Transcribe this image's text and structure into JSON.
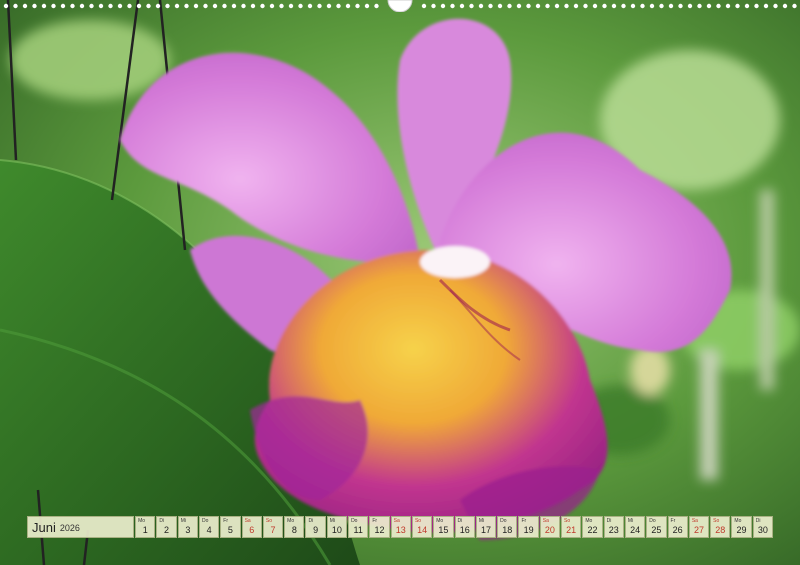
{
  "calendar": {
    "month": "Juni",
    "year": "2026",
    "days": [
      {
        "wd": "Mo",
        "d": "1",
        "weekend": false
      },
      {
        "wd": "Di",
        "d": "2",
        "weekend": false
      },
      {
        "wd": "Mi",
        "d": "3",
        "weekend": false
      },
      {
        "wd": "Do",
        "d": "4",
        "weekend": false
      },
      {
        "wd": "Fr",
        "d": "5",
        "weekend": false
      },
      {
        "wd": "Sa",
        "d": "6",
        "weekend": true
      },
      {
        "wd": "So",
        "d": "7",
        "weekend": true
      },
      {
        "wd": "Mo",
        "d": "8",
        "weekend": false
      },
      {
        "wd": "Di",
        "d": "9",
        "weekend": false
      },
      {
        "wd": "Mi",
        "d": "10",
        "weekend": false
      },
      {
        "wd": "Do",
        "d": "11",
        "weekend": false
      },
      {
        "wd": "Fr",
        "d": "12",
        "weekend": false
      },
      {
        "wd": "Sa",
        "d": "13",
        "weekend": true
      },
      {
        "wd": "So",
        "d": "14",
        "weekend": true
      },
      {
        "wd": "Mo",
        "d": "15",
        "weekend": false
      },
      {
        "wd": "Di",
        "d": "16",
        "weekend": false
      },
      {
        "wd": "Mi",
        "d": "17",
        "weekend": false
      },
      {
        "wd": "Do",
        "d": "18",
        "weekend": false
      },
      {
        "wd": "Fr",
        "d": "19",
        "weekend": false
      },
      {
        "wd": "Sa",
        "d": "20",
        "weekend": true
      },
      {
        "wd": "So",
        "d": "21",
        "weekend": true
      },
      {
        "wd": "Mo",
        "d": "22",
        "weekend": false
      },
      {
        "wd": "Di",
        "d": "23",
        "weekend": false
      },
      {
        "wd": "Mi",
        "d": "24",
        "weekend": false
      },
      {
        "wd": "Do",
        "d": "25",
        "weekend": false
      },
      {
        "wd": "Fr",
        "d": "26",
        "weekend": false
      },
      {
        "wd": "Sa",
        "d": "27",
        "weekend": true
      },
      {
        "wd": "So",
        "d": "28",
        "weekend": true
      },
      {
        "wd": "Mo",
        "d": "29",
        "weekend": false
      },
      {
        "wd": "Di",
        "d": "30",
        "weekend": false
      }
    ]
  },
  "colors": {
    "weekend_text": "#c0392b",
    "petal": "#c45bd0",
    "lip_yellow": "#f2c029",
    "leaf": "#2f6b22",
    "background_green": "#6aa84f"
  }
}
